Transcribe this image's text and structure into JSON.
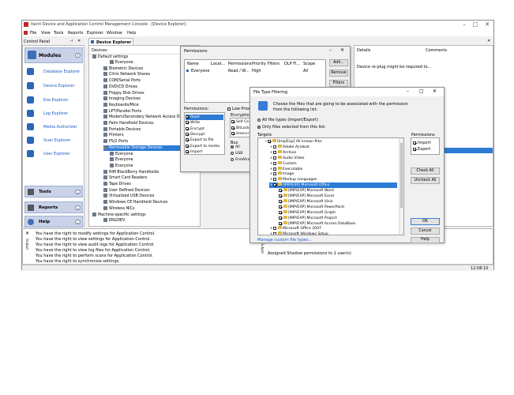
{
  "window": {
    "title": "Itanti Device and Application Control Management Console - [Device Explorer]"
  },
  "menu": [
    "File",
    "View",
    "Tools",
    "Reports",
    "Explorer",
    "Window",
    "Help"
  ],
  "control_panel": {
    "title": "Control Panel",
    "modules_label": "Modules",
    "items": [
      "Database Explorer",
      "Device Explorer",
      "Exe Explorer",
      "Log Explorer",
      "Media Authorizer",
      "Scan Explorer",
      "User Explorer"
    ],
    "tools_label": "Tools",
    "reports_label": "Reports",
    "help_label": "Help"
  },
  "tab": {
    "label": "Device Explorer"
  },
  "tree": {
    "header": "Devices",
    "root": "Default settings",
    "rows": [
      "Everyone",
      "Biometric Devices",
      "Citrix Network Shares",
      "COM/Serial Ports",
      "DVD/CD Drives",
      "Floppy Disk Drives",
      "Imaging Devices",
      "Keyboards/Mice",
      "LPT/Parallel Ports",
      "Modem/Secondary Network Access Devi",
      "Palm Handheld Devices",
      "Portable Devices",
      "Printers",
      "PS/2 Ports",
      "Removable Storage Devices",
      "Everyone",
      "Everyone",
      "Everyone",
      "RIM BlackBerry Handhelds",
      "Smart Card Readers",
      "Tape Drives",
      "User Defined Devices",
      "Virtualized USB Devices",
      "Windows CE Handheld Devices",
      "Wireless NICs"
    ],
    "machine": "Machine-specific settings",
    "machine_child": "ENGDEV"
  },
  "right_grid": {
    "col_details": "Details",
    "col_comments": "Comments",
    "row1": "Device re-plug might be required to..."
  },
  "log": {
    "lines": [
      "You have the right to modify settings for Application Control.",
      "You have the right to view settings for Application Control.",
      "You have the right to view audit logs for Application Control.",
      "You have the right to view log files for Application Control.",
      "You have the right to perform scans for Application Control.",
      "You have the right to synchronize settings."
    ],
    "right1": "Assigned Shadow permissions to 1 user(s)",
    "side_label": "Output"
  },
  "status": {
    "time": "12:08:10"
  },
  "perm_dialog": {
    "title": "Permissions",
    "cols": [
      "Name",
      "Locat...",
      "Permissions",
      "Priority",
      "Filters",
      "DLP Fi...",
      "Scope"
    ],
    "row": [
      "Everyone",
      "",
      "Read / W...",
      "High",
      "",
      "",
      "All"
    ],
    "add": "Add...",
    "remove": "Remove",
    "filters": "Filters",
    "permissions_label": "Permissions:",
    "perm_items": [
      "Read",
      "Write",
      "Encrypt",
      "Decrypt",
      "Export to file",
      "Export to media",
      "Import"
    ],
    "low_priority": "Low Priority",
    "encryption_label": "Encryption",
    "enc_items": [
      "Self Co",
      "BitLock",
      "Unencr"
    ],
    "bus_label": "Bus",
    "bus_items": [
      "All",
      "USB",
      "FireWire"
    ]
  },
  "ftf_dialog": {
    "title": "File Type Filtering",
    "desc": "Choose the files that are going to be associated with the permission from the following list:",
    "opt_all": "All file types (Import/Export)",
    "opt_only": "Only files selected from this list:",
    "targets_label": "Targets",
    "permissions_label": "Permissions",
    "perm_import": "Import",
    "perm_export": "Export",
    "files": [
      "[Imp/Exp] All known files",
      "Adobe Acrobat",
      "Archive",
      "Audio Video",
      "Custom",
      "Executable",
      "Image",
      "Markup Languages",
      "[IMP/EXP] Microsoft Office",
      "[IMP/EXP] Microsoft Word",
      "[IMP/EXP] Microsoft Excel",
      "[IMP/EXP] Microsoft Visio",
      "[IMP/EXP] Microsoft PowerPoint",
      "[IMP/EXP] Microsoft Graph",
      "[IMP/EXP] Microsoft Project",
      "[IMP/EXP] Microsoft Access DataBase",
      "Microsoft Office 2007",
      "Microsoft Windows Setup"
    ],
    "check_all": "Check All",
    "uncheck_all": "Uncheck All",
    "ok": "OK",
    "cancel": "Cancel",
    "help": "Help",
    "manage_link": "Manage custom file types..."
  }
}
